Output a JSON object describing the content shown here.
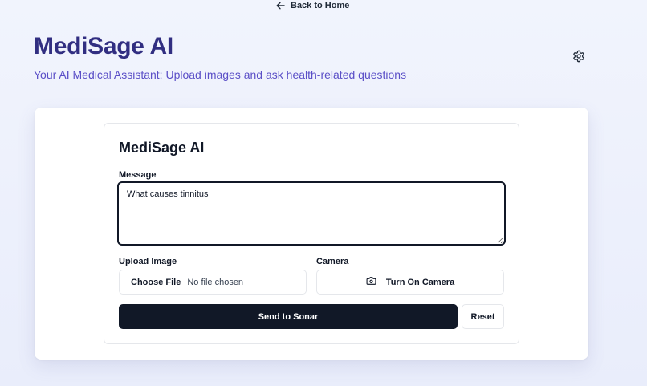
{
  "nav": {
    "back_label": "Back to Home",
    "back_icon": "arrow-left-icon"
  },
  "header": {
    "title": "MediSage AI",
    "subtitle": "Your AI Medical Assistant: Upload images and ask health-related questions",
    "settings_icon": "gear-icon"
  },
  "form": {
    "title": "MediSage AI",
    "message_label": "Message",
    "message_value": "What causes tinnitus",
    "upload_label": "Upload Image",
    "choose_file_label": "Choose File",
    "file_status": "No file chosen",
    "camera_label": "Camera",
    "camera_button_label": "Turn On Camera",
    "camera_icon": "camera-icon",
    "send_label": "Send to Sonar",
    "reset_label": "Reset"
  },
  "colors": {
    "brand": "#312e81",
    "subtitle": "#5b4fc7",
    "primary_button": "#111827",
    "background": "#eef1fc"
  }
}
